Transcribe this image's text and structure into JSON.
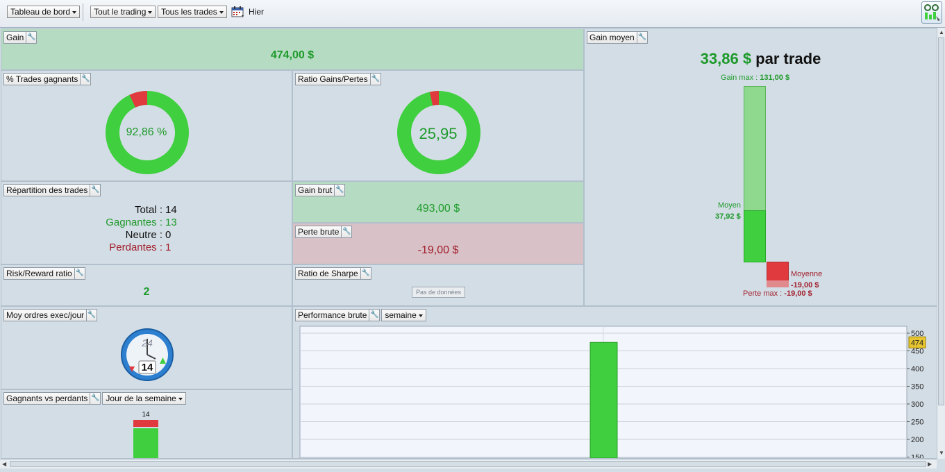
{
  "toolbar": {
    "dashboard_label": "Tableau de bord",
    "trading_label": "Tout le trading",
    "trades_label": "Tous les trades",
    "date_label": "Hier"
  },
  "panels": {
    "gain": {
      "title": "Gain",
      "value": "474,00 $"
    },
    "win_pct": {
      "title": "% Trades gagnants",
      "value": "92,86 %",
      "fraction": 0.9286
    },
    "ratio_gp": {
      "title": "Ratio Gains/Pertes",
      "value": "25,95",
      "fraction": 0.9629
    },
    "repartition": {
      "title": "Répartition des trades",
      "rows": [
        {
          "key": "Total :",
          "value": "14"
        },
        {
          "key": "Gagnantes :",
          "value": "13"
        },
        {
          "key": "Neutre :",
          "value": "0"
        },
        {
          "key": "Perdantes :",
          "value": "1"
        }
      ]
    },
    "gain_brut": {
      "title": "Gain brut",
      "value": "493,00 $"
    },
    "perte_brute": {
      "title": "Perte brute",
      "value": "-19,00 $"
    },
    "risk_reward": {
      "title": "Risk/Reward ratio",
      "value": "2"
    },
    "sharpe": {
      "title": "Ratio de Sharpe",
      "nodata": "Pas de données"
    },
    "moy_ordres": {
      "title": "Moy ordres exec/jour",
      "value": "14",
      "clock_label": "24"
    },
    "gagnants_perdants": {
      "title": "Gagnants vs perdants",
      "select": "Jour de la semaine",
      "bar_label": "14",
      "winners": 13,
      "losers": 1
    },
    "perf_brute": {
      "title": "Performance brute",
      "select": "semaine"
    },
    "gain_moyen": {
      "title": "Gain moyen",
      "headline_value": "33,86 $",
      "headline_suffix": " par trade",
      "gain_max_label": "Gain max : ",
      "gain_max_value": "131,00 $",
      "moyen_label": "Moyen",
      "moyen_value": "37,92 $",
      "moyenne_label": "Moyenne",
      "moyenne_value": "-19,00 $",
      "perte_max_label": "Perte max : ",
      "perte_max_value": "-19,00 $"
    }
  },
  "colors": {
    "green": "#3fcf3f",
    "red": "#e0393e",
    "text_green": "#1e9a2b",
    "text_red": "#a11e2b"
  },
  "chart_data": {
    "type": "bar",
    "categories": [
      ""
    ],
    "values": [
      474
    ],
    "ylim": [
      150,
      500
    ],
    "yticks": [
      "500",
      "450",
      "400",
      "350",
      "300",
      "250",
      "200",
      "150"
    ],
    "current_value_label": "474",
    "grid": true
  }
}
